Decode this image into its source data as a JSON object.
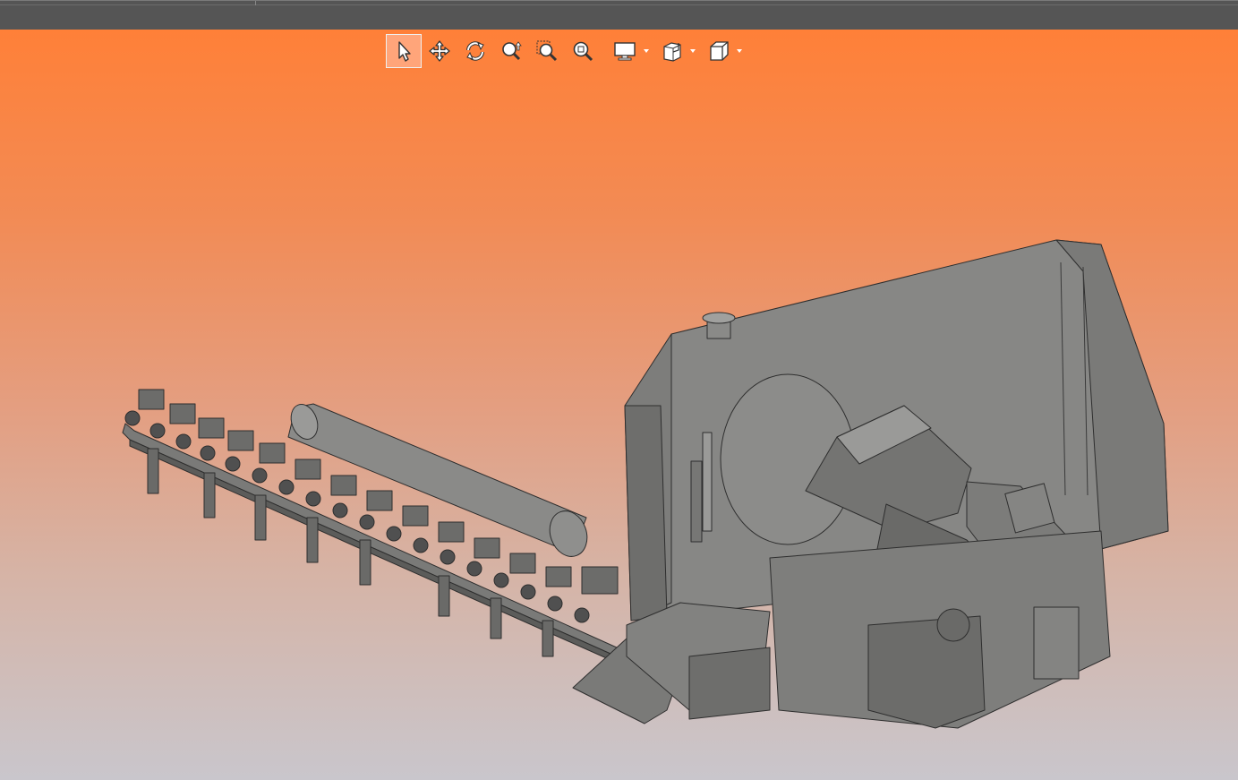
{
  "window": {
    "title": ""
  },
  "toolbar": {
    "buttons": [
      {
        "name": "select-tool",
        "icon": "pointer-arrow-icon",
        "active": true
      },
      {
        "name": "pan-tool",
        "icon": "move-arrows-icon"
      },
      {
        "name": "rotate-tool",
        "icon": "rotate-icon"
      },
      {
        "name": "zoom-dynamic-tool",
        "icon": "zoom-updown-icon"
      },
      {
        "name": "zoom-window-tool",
        "icon": "zoom-window-icon"
      },
      {
        "name": "zoom-fit-tool",
        "icon": "zoom-fit-icon"
      },
      {
        "name": "display-mode-menu",
        "icon": "monitor-icon",
        "dropdown": true
      },
      {
        "name": "section-view-menu",
        "icon": "section-cube-icon",
        "dropdown": true
      },
      {
        "name": "standard-views-menu",
        "icon": "view-cube-icon",
        "dropdown": true
      }
    ]
  },
  "colors": {
    "topbar": "#555555",
    "gradient_top": "#ff8038",
    "gradient_bottom": "#c9c6cc",
    "model_gray": "#888886",
    "model_dark": "#5c5c5a",
    "active_button": "#ffa57a"
  }
}
